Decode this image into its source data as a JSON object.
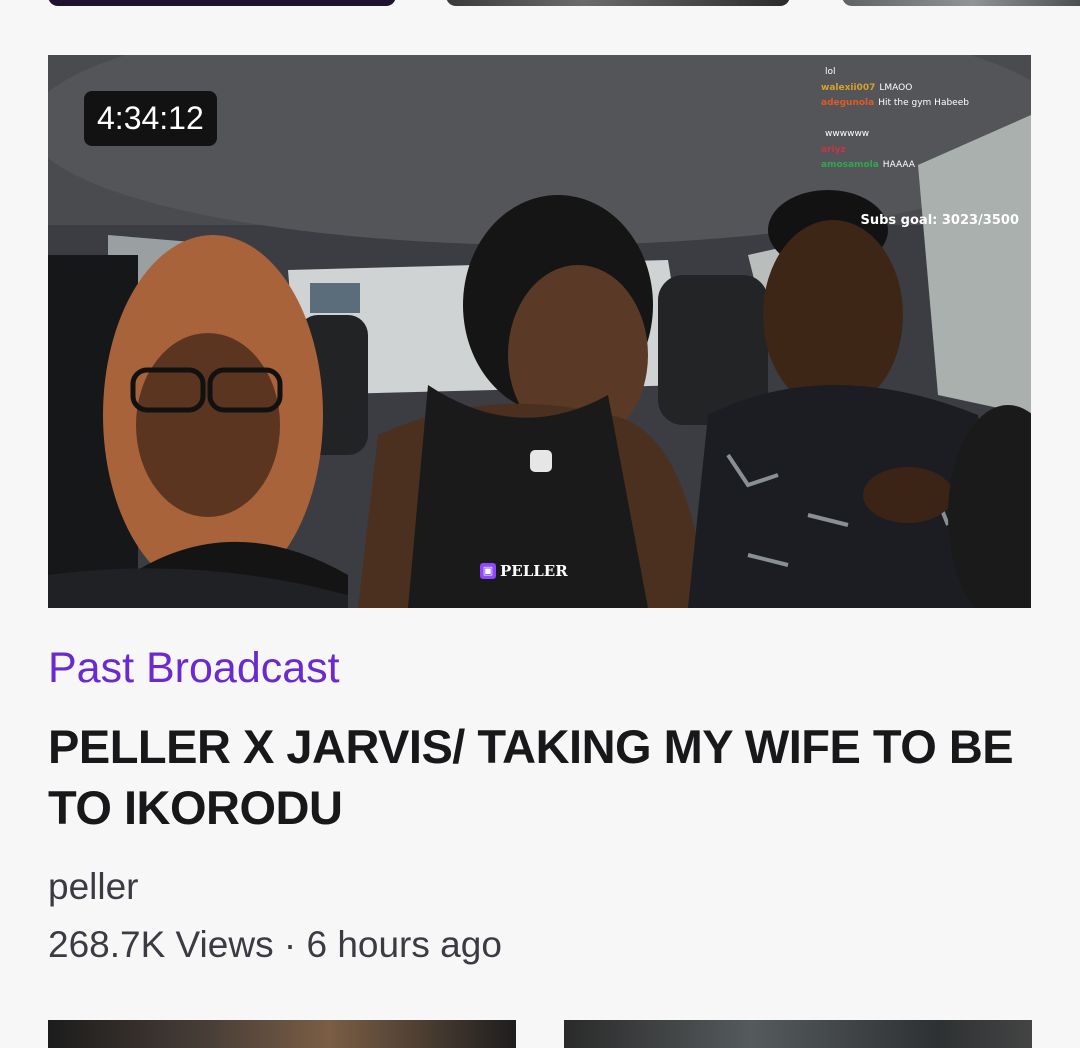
{
  "video": {
    "duration": "4:34:12",
    "category": "Past Broadcast",
    "title": "PELLER X JARVIS/ TAKING MY WIFE TO BE TO IKORODU",
    "channel": "peller",
    "views": "268.7K Views",
    "separator": "·",
    "age": "6 hours ago"
  },
  "overlay": {
    "watermark": "PELLER",
    "subs_goal": "Subs goal: 3023/3500",
    "chat": [
      {
        "user": "",
        "msg": "lol",
        "color": "#ffffff"
      },
      {
        "user": "walexii007",
        "msg": "LMAOO",
        "color": "#d8a12a"
      },
      {
        "user": "adegunola",
        "msg": "Hit the gym Habeeb",
        "color": "#e05a24"
      },
      {
        "user": "",
        "msg": "",
        "color": "#5b5bff"
      },
      {
        "user": "",
        "msg": "wwwwww",
        "color": "#e0403c"
      },
      {
        "user": "ariyz",
        "msg": "",
        "color": "#cc3344"
      },
      {
        "user": "amosamola",
        "msg": "HAAAA",
        "color": "#2fa84f"
      },
      {
        "user": "",
        "msg": "",
        "color": "#8a3cff"
      }
    ]
  },
  "colors": {
    "accent": "#6a2ad0",
    "text_primary": "#18181b",
    "text_secondary": "#3b3b44",
    "background": "#f7f7f8"
  }
}
